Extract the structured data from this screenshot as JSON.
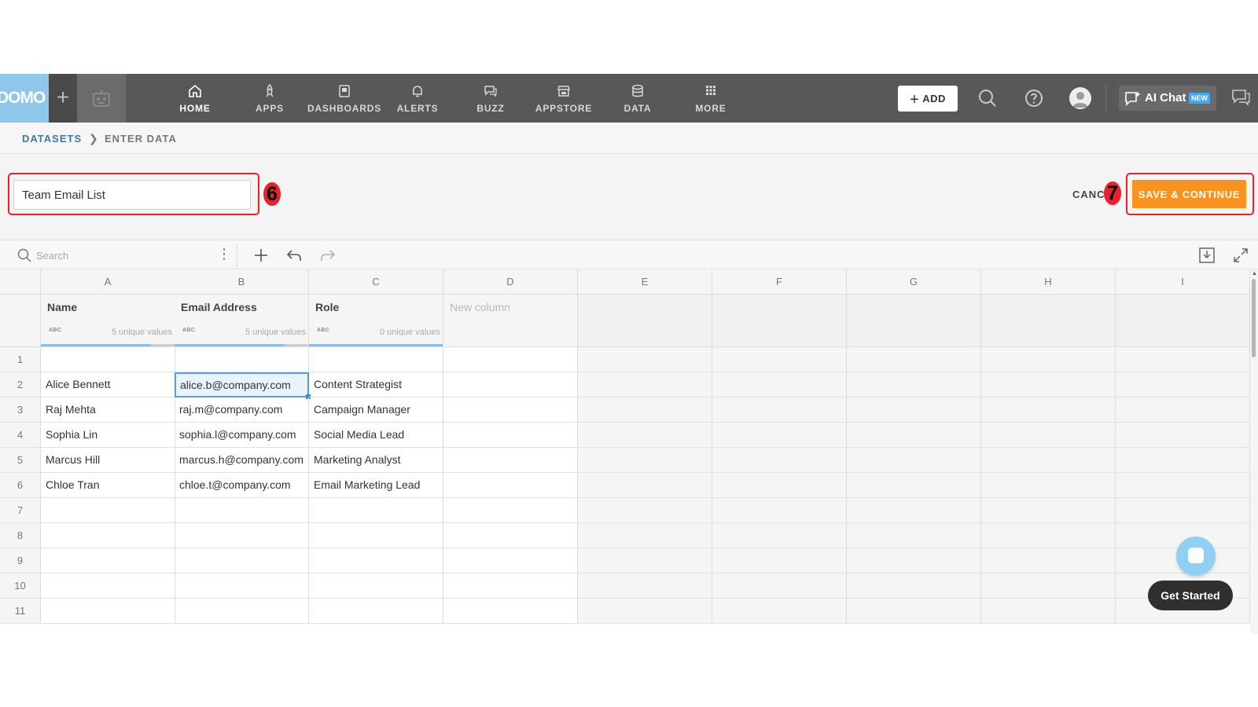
{
  "app": {
    "logo_text": "DOMO",
    "nav": [
      {
        "label": "HOME",
        "icon": "home-icon",
        "active": true
      },
      {
        "label": "APPS",
        "icon": "rocket-icon"
      },
      {
        "label": "DASHBOARDS",
        "icon": "dashboards-icon"
      },
      {
        "label": "ALERTS",
        "icon": "bell-icon"
      },
      {
        "label": "BUZZ",
        "icon": "chat-bubbles-icon"
      },
      {
        "label": "APPSTORE",
        "icon": "store-icon"
      },
      {
        "label": "DATA",
        "icon": "database-icon"
      },
      {
        "label": "MORE",
        "icon": "grid-dots-icon"
      }
    ],
    "add_label": "ADD",
    "ai_chat_label": "AI Chat",
    "ai_chat_badge": "NEW",
    "colors": {
      "nav_bg": "#585858",
      "logo_bg": "#8fc7ea",
      "accent_orange": "#f7931e",
      "highlight_red": "#e8222c",
      "link_blue": "#3e7aa8"
    }
  },
  "breadcrumb": {
    "root": "DATASETS",
    "current": "ENTER DATA"
  },
  "dataset": {
    "name": "Team Email List"
  },
  "annotations": {
    "step_name": "6",
    "step_save": "7"
  },
  "actions": {
    "cancel_label": "CANCEL",
    "save_label": "SAVE & CONTINUE"
  },
  "toolbar": {
    "search_placeholder": "Search"
  },
  "grid": {
    "column_letters": [
      "A",
      "B",
      "C",
      "D",
      "E",
      "F",
      "G",
      "H",
      "I"
    ],
    "fields": [
      {
        "name": "Name",
        "type": "ABC",
        "unique": "5 unique values"
      },
      {
        "name": "Email Address",
        "type": "ABC",
        "unique": "5 unique values"
      },
      {
        "name": "Role",
        "type": "ABC",
        "unique": "0 unique values"
      },
      {
        "name": "New column"
      }
    ],
    "row_numbers": [
      "1",
      "2",
      "3",
      "4",
      "5",
      "6",
      "7",
      "8",
      "9",
      "10",
      "11"
    ],
    "rows": [
      [
        "",
        "",
        ""
      ],
      [
        "Alice Bennett",
        "alice.b@company.com",
        "Content Strategist"
      ],
      [
        "Raj Mehta",
        "raj.m@company.com",
        "Campaign Manager"
      ],
      [
        "Sophia Lin",
        "sophia.l@company.com",
        "Social Media Lead"
      ],
      [
        "Marcus Hill",
        "marcus.h@company.com",
        "Marketing Analyst"
      ],
      [
        "Chloe Tran",
        "chloe.t@company.com",
        "Email Marketing Lead"
      ],
      [
        "",
        "",
        ""
      ],
      [
        "",
        "",
        ""
      ],
      [
        "",
        "",
        ""
      ],
      [
        "",
        "",
        ""
      ],
      [
        "",
        "",
        ""
      ]
    ],
    "selected_cell": "B2"
  },
  "help": {
    "get_started_label": "Get Started"
  }
}
